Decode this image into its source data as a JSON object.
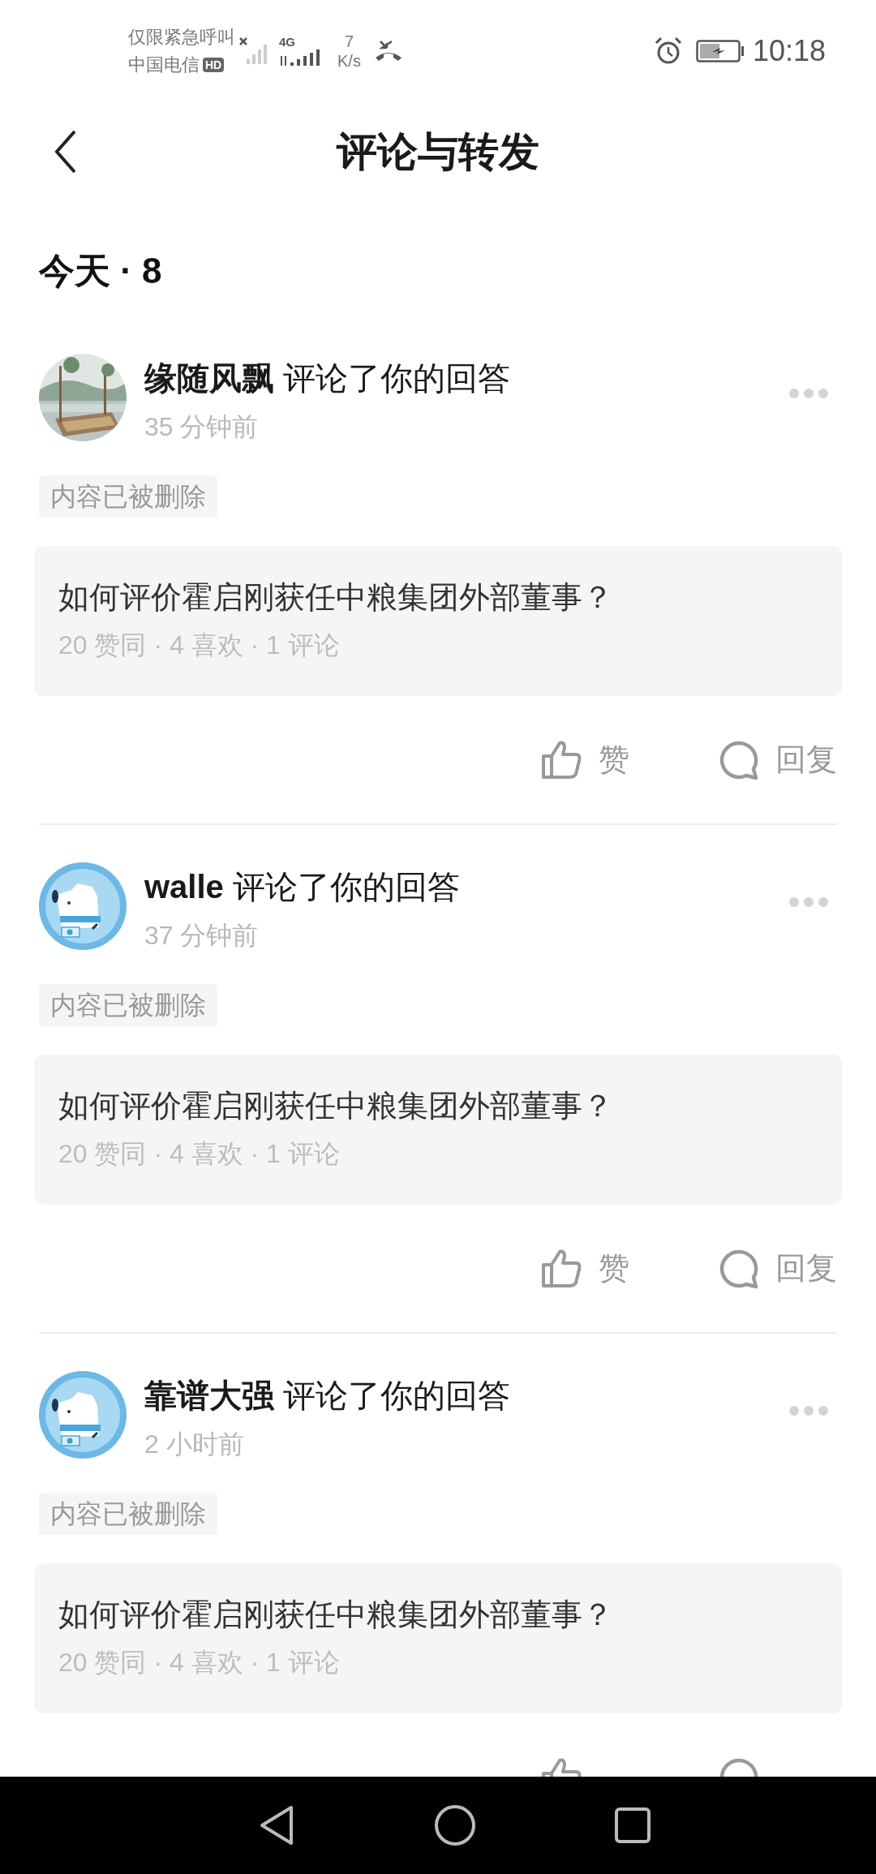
{
  "status_bar": {
    "carrier_note": "仅限紧急呼叫",
    "carrier": "中国电信",
    "hd_badge": "HD",
    "network": "4G",
    "speed_value": "7",
    "speed_unit": "K/s",
    "time": "10:18"
  },
  "header": {
    "title": "评论与转发"
  },
  "section": {
    "title": "今天 · 8"
  },
  "notifications": [
    {
      "user": "缘随风飘",
      "action": "评论了你的回答",
      "time": "35 分钟前",
      "tag": "内容已被删除",
      "question": "如何评价霍启刚获任中粮集团外部董事？",
      "stats": "20 赞同 · 4 喜欢 · 1 评论",
      "like": "赞",
      "reply": "回复"
    },
    {
      "avatar": {
        "kind": "default"
      },
      "user": "walle",
      "action": "评论了你的回答",
      "time": "37 分钟前",
      "tag": "内容已被删除",
      "question": "如何评价霍启刚获任中粮集团外部董事？",
      "stats": "20 赞同 · 4 喜欢 · 1 评论",
      "like": "赞",
      "reply": "回复"
    },
    {
      "avatar": {
        "kind": "default"
      },
      "user": "靠谱大强",
      "action": "评论了你的回答",
      "time": "2 小时前",
      "tag": "内容已被删除",
      "question": "如何评价霍启刚获任中粮集团外部董事？",
      "stats": "20 赞同 · 4 喜欢 · 1 评论"
    }
  ]
}
